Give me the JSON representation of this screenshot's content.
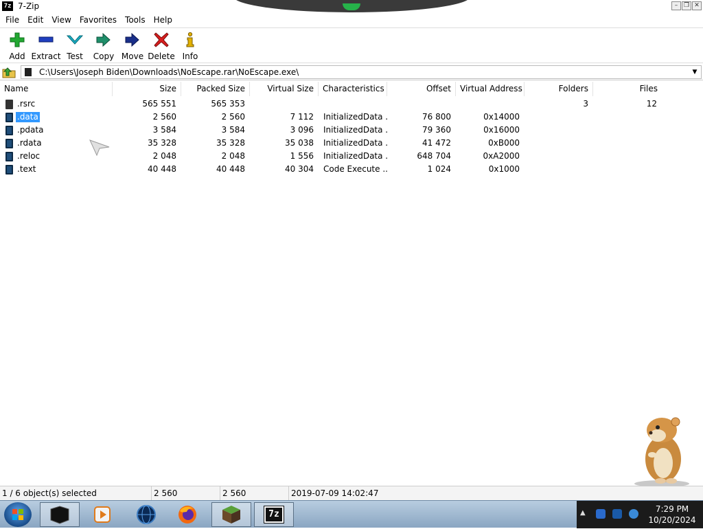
{
  "window": {
    "title": "7-Zip",
    "app_icon_text": "7z"
  },
  "menu": [
    "File",
    "Edit",
    "View",
    "Favorites",
    "Tools",
    "Help"
  ],
  "toolbar": [
    {
      "label": "Add",
      "icon": "plus-icon",
      "color": "#22a832"
    },
    {
      "label": "Extract",
      "icon": "minus-icon",
      "color": "#1f3fbf"
    },
    {
      "label": "Test",
      "icon": "check-icon",
      "color": "#1a9fb5"
    },
    {
      "label": "Copy",
      "icon": "copy-arrow-icon",
      "color": "#1f8f6a"
    },
    {
      "label": "Move",
      "icon": "move-arrow-icon",
      "color": "#1a2f8a"
    },
    {
      "label": "Delete",
      "icon": "delete-x-icon",
      "color": "#d81e1e"
    },
    {
      "label": "Info",
      "icon": "info-icon",
      "color": "#c89b00"
    }
  ],
  "address": {
    "path": "C:\\Users\\Joseph Biden\\Downloads\\NoEscape.rar\\NoEscape.exe\\"
  },
  "columns": [
    "Name",
    "Size",
    "Packed Size",
    "Virtual Size",
    "Characteristics",
    "Offset",
    "Virtual Address",
    "Folders",
    "Files"
  ],
  "rows": [
    {
      "name": ".rsrc",
      "size": "565 551",
      "packed": "565 353",
      "vsize": "",
      "chars": "",
      "offset": "",
      "vaddr": "",
      "folders": "3",
      "files": "12",
      "icon": "folder",
      "selected": false
    },
    {
      "name": ".data",
      "size": "2 560",
      "packed": "2 560",
      "vsize": "7 112",
      "chars": "InitializedData ...",
      "offset": "76 800",
      "vaddr": "0x14000",
      "folders": "",
      "files": "",
      "icon": "file",
      "selected": true
    },
    {
      "name": ".pdata",
      "size": "3 584",
      "packed": "3 584",
      "vsize": "3 096",
      "chars": "InitializedData ...",
      "offset": "79 360",
      "vaddr": "0x16000",
      "folders": "",
      "files": "",
      "icon": "file",
      "selected": false
    },
    {
      "name": ".rdata",
      "size": "35 328",
      "packed": "35 328",
      "vsize": "35 038",
      "chars": "InitializedData ...",
      "offset": "41 472",
      "vaddr": "0xB000",
      "folders": "",
      "files": "",
      "icon": "file",
      "selected": false
    },
    {
      "name": ".reloc",
      "size": "2 048",
      "packed": "2 048",
      "vsize": "1 556",
      "chars": "InitializedData ...",
      "offset": "648 704",
      "vaddr": "0xA2000",
      "folders": "",
      "files": "",
      "icon": "file",
      "selected": false
    },
    {
      "name": ".text",
      "size": "40 448",
      "packed": "40 448",
      "vsize": "40 304",
      "chars": "Code Execute ...",
      "offset": "1 024",
      "vaddr": "0x1000",
      "folders": "",
      "files": "",
      "icon": "file",
      "selected": false
    }
  ],
  "status": {
    "selection": "1 / 6 object(s) selected",
    "size": "2 560",
    "packed": "2 560",
    "date": "2019-07-09 14:02:47"
  },
  "taskbar": {
    "items": [
      "black-box-app-icon",
      "media-player-icon",
      "globe-app-icon",
      "firefox-icon",
      "minecraft-icon",
      "sevenzip-icon"
    ],
    "sevenzip_text": "7z",
    "time": "7:29 PM",
    "date": "10/20/2024"
  }
}
